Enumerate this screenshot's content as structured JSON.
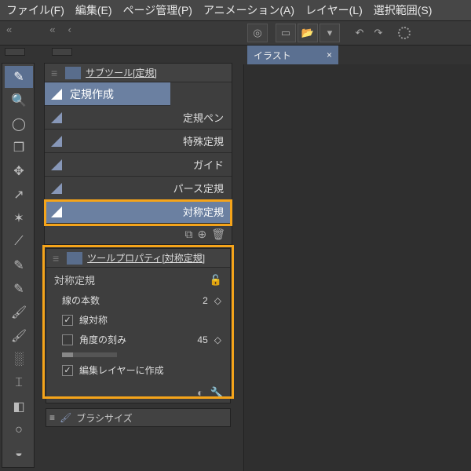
{
  "menu": {
    "file": "ファイル(F)",
    "edit": "編集(E)",
    "page": "ページ管理(P)",
    "anim": "アニメーション(A)",
    "layer": "レイヤー(L)",
    "select": "選択範囲(S)"
  },
  "subtool": {
    "header": "サブツール[定規]",
    "category": "定規作成",
    "items": [
      "定規ペン",
      "特殊定規",
      "ガイド",
      "パース定規",
      "対称定規"
    ]
  },
  "prop": {
    "header": "ツールプロパティ[対称定規]",
    "title": "対称定規",
    "lines_label": "線の本数",
    "lines_value": "2",
    "line_sym": "線対称",
    "angle_step": "角度の刻み",
    "angle_value": "45",
    "create_on_layer": "編集レイヤーに作成",
    "checked": "✓"
  },
  "brush": {
    "label": "ブラシサイズ"
  },
  "doctab": {
    "label": "イラスト",
    "close": "×"
  },
  "icons": {
    "undo": "↶",
    "redo": "↷",
    "updown": "◇"
  }
}
